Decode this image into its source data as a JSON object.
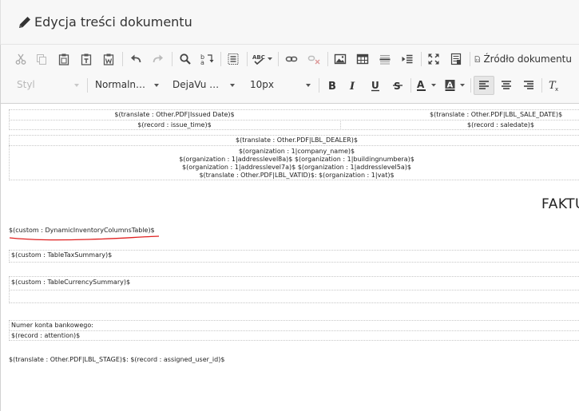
{
  "header": {
    "title": "Edycja treści dokumentu",
    "icon": "pencil-icon"
  },
  "toolbar": {
    "row1_icons": [
      "cut-icon",
      "copy-icon",
      "paste-icon",
      "paste-text-icon",
      "paste-word-icon",
      "undo-icon",
      "redo-icon",
      "find-icon",
      "replace-icon",
      "select-all-icon",
      "spellcheck-icon",
      "link-icon",
      "unlink-icon",
      "image-icon",
      "table-icon",
      "horizontal-line-icon",
      "insert-placeholder-icon",
      "maximize-icon",
      "show-blocks-icon",
      "source-icon"
    ],
    "source_label": "Źródło dokumentu",
    "style_combo": "Styl",
    "format_combo": "Normaln…",
    "font_combo": "DejaVu …",
    "size_combo": "10px",
    "row2_icons": [
      "bold-icon",
      "italic-icon",
      "underline-icon",
      "strikethrough-icon",
      "text-color-icon",
      "background-color-icon",
      "align-left-icon",
      "align-center-icon",
      "align-right-icon",
      "remove-format-icon"
    ]
  },
  "document": {
    "issued_date_label": "$(translate : Other.PDF|Issued Date)$",
    "sale_date_label": "$(translate : Other.PDF|LBL_SALE_DATE)$",
    "issue_time": "$(record : issue_time)$",
    "saledate": "$(record : saledate)$",
    "dealer_label": "$(translate : Other.PDF|LBL_DEALER)$",
    "org_line1": "$(organization : 1|company_name)$",
    "org_line2": "$(organization : 1|addresslevel8a)$ $(organization : 1|buildingnumbera)$",
    "org_line3": "$(organization : 1|addresslevel7a)$ $(organization : 1|addresslevel5a)$",
    "org_line4": "$(translate : Other.PDF|LBL_VATID)$: $(organization : 1|vat)$",
    "invoice_title": "FAKTU",
    "inventory_table": "$(custom : DynamicInventoryColumnsTable)$",
    "tax_summary": "$(custom : TableTaxSummary)$",
    "currency_summary": "$(custom : TableCurrencySummary)$",
    "bank_account_label": "Numer konta bankowego:",
    "attention": "$(record : attention)$",
    "stage_line": "$(translate : Other.PDF|LBL_STAGE)$: $(record : assigned_user_id)$"
  },
  "colors": {
    "toolbar_bg": "#f8f8f8",
    "header_bg": "#f7f7f7",
    "annotation_red": "#e02020",
    "icon_gray": "#555555",
    "disabled_gray": "#b8b8b8"
  }
}
